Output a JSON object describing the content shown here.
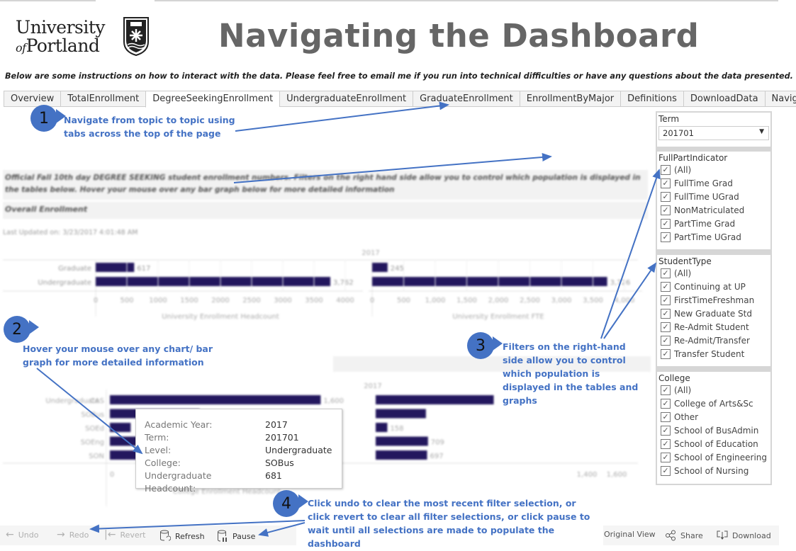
{
  "header": {
    "logo": {
      "line1": "University",
      "line2_of": "of",
      "line2_name": "Portland"
    },
    "title": "Navigating the Dashboard",
    "intro": "Below are some instructions on how to interact with the data. Please feel free to email me if you run into technical difficulties or have any questions about the data presented."
  },
  "tabs": [
    {
      "label": "Overview",
      "active": false
    },
    {
      "label": "TotalEnrollment",
      "active": false
    },
    {
      "label": "DegreeSeekingEnrollment",
      "active": true
    },
    {
      "label": "UndergraduateEnrollment",
      "active": false
    },
    {
      "label": "GraduateEnrollment",
      "active": false
    },
    {
      "label": "EnrollmentByMajor",
      "active": false
    },
    {
      "label": "Definitions",
      "active": false
    },
    {
      "label": "DownloadData",
      "active": false
    },
    {
      "label": "Navigation",
      "active": false
    }
  ],
  "dashboard": {
    "description": "Official Fall 10th day DEGREE SEEKING student enrollment numbers. Filters on the right hand side allow you to control which population is displayed in the tables below. Hover your mouse over any bar graph below for more detailed information",
    "section_title": "Overall Enrollment",
    "last_updated": "Last Updated on: 3/23/2017 4:01:48 AM",
    "bar_color": "#23175e"
  },
  "chart_data": [
    {
      "type": "bar",
      "title": "2017",
      "categories": [
        "Graduate",
        "Undergraduate"
      ],
      "values": [
        617,
        3762
      ],
      "value_labels": [
        "617",
        "3,762"
      ],
      "xlabel": "University Enrollment Headcount",
      "xlim": [
        0,
        4000
      ],
      "ticks": [
        "0",
        "500",
        "1000",
        "1500",
        "2000",
        "2500",
        "3000",
        "3500",
        "4000"
      ]
    },
    {
      "type": "bar",
      "title": "",
      "categories": [
        "Graduate",
        "Undergraduate"
      ],
      "values": [
        245,
        3726
      ],
      "value_labels": [
        "245",
        "3,726"
      ],
      "xlabel": "University Enrollment FTE",
      "xlim": [
        0,
        4000
      ],
      "ticks": [
        "0",
        "500",
        "1,000",
        "1,500",
        "2,000",
        "2,500",
        "3,000",
        "3,500",
        "4,000"
      ]
    },
    {
      "type": "bar",
      "title": "2017",
      "group_label": "Undergraduate",
      "categories": [
        "CAS",
        "SOBus",
        "SOEd",
        "SOEng",
        "SON"
      ],
      "values": [
        1600,
        681,
        158,
        709,
        697
      ],
      "value_labels": [
        "1,600",
        "681",
        "158",
        "709",
        "697"
      ],
      "xlabel": "College Enrollment Headcount",
      "xlim": [
        0,
        1700
      ],
      "ticks": [
        "0",
        "1,400",
        "1,600"
      ]
    }
  ],
  "tooltip": {
    "rows": [
      {
        "key": "Academic Year:",
        "value": "2017"
      },
      {
        "key": "Term:",
        "value": "201701"
      },
      {
        "key": "Level:",
        "value": "Undergraduate"
      },
      {
        "key": "College:",
        "value": "SOBus"
      },
      {
        "key": "Undergraduate Headcount:",
        "value": "681"
      }
    ]
  },
  "filters": {
    "term": {
      "title": "Term",
      "value": "201701"
    },
    "full_part": {
      "title": "FullPartIndicator",
      "items": [
        "(All)",
        "FullTime Grad",
        "FullTime UGrad",
        "NonMatriculated",
        "PartTime Grad",
        "PartTime UGrad"
      ]
    },
    "student_type": {
      "title": "StudentType",
      "items": [
        "(All)",
        "Continuing at UP",
        "FirstTimeFreshman",
        "New Graduate Std",
        "Re-Admit Student",
        "Re-Admit/Transfer",
        "Transfer Student"
      ]
    },
    "college": {
      "title": "College",
      "items": [
        "(All)",
        "College of Arts&Sc",
        "Other",
        "School of BusAdmin",
        "School of Education",
        "School of Engineering",
        "School of Nursing"
      ]
    },
    "check_glyph": "✓"
  },
  "annotations": [
    {
      "number": "1",
      "text": "Navigate from topic to topic using tabs across the top of the page"
    },
    {
      "number": "2",
      "text": "Hover your mouse over any chart/ bar graph for more detailed information"
    },
    {
      "number": "3",
      "text": "Filters on the right-hand side allow you to control which population is displayed in the tables and graphs"
    },
    {
      "number": "4",
      "text": "Click undo to clear the most recent filter selection, or click revert to clear all filter selections, or click pause to wait until all selections are made to populate the dashboard"
    }
  ],
  "annotation_color": "#4472c4",
  "toolbar": {
    "undo": "Undo",
    "redo": "Redo",
    "revert": "Revert",
    "refresh": "Refresh",
    "pause": "Pause",
    "original_view": "Original View",
    "share": "Share",
    "download": "Download",
    "icons": {
      "undo": "←",
      "redo": "→",
      "revert": "|←"
    }
  }
}
